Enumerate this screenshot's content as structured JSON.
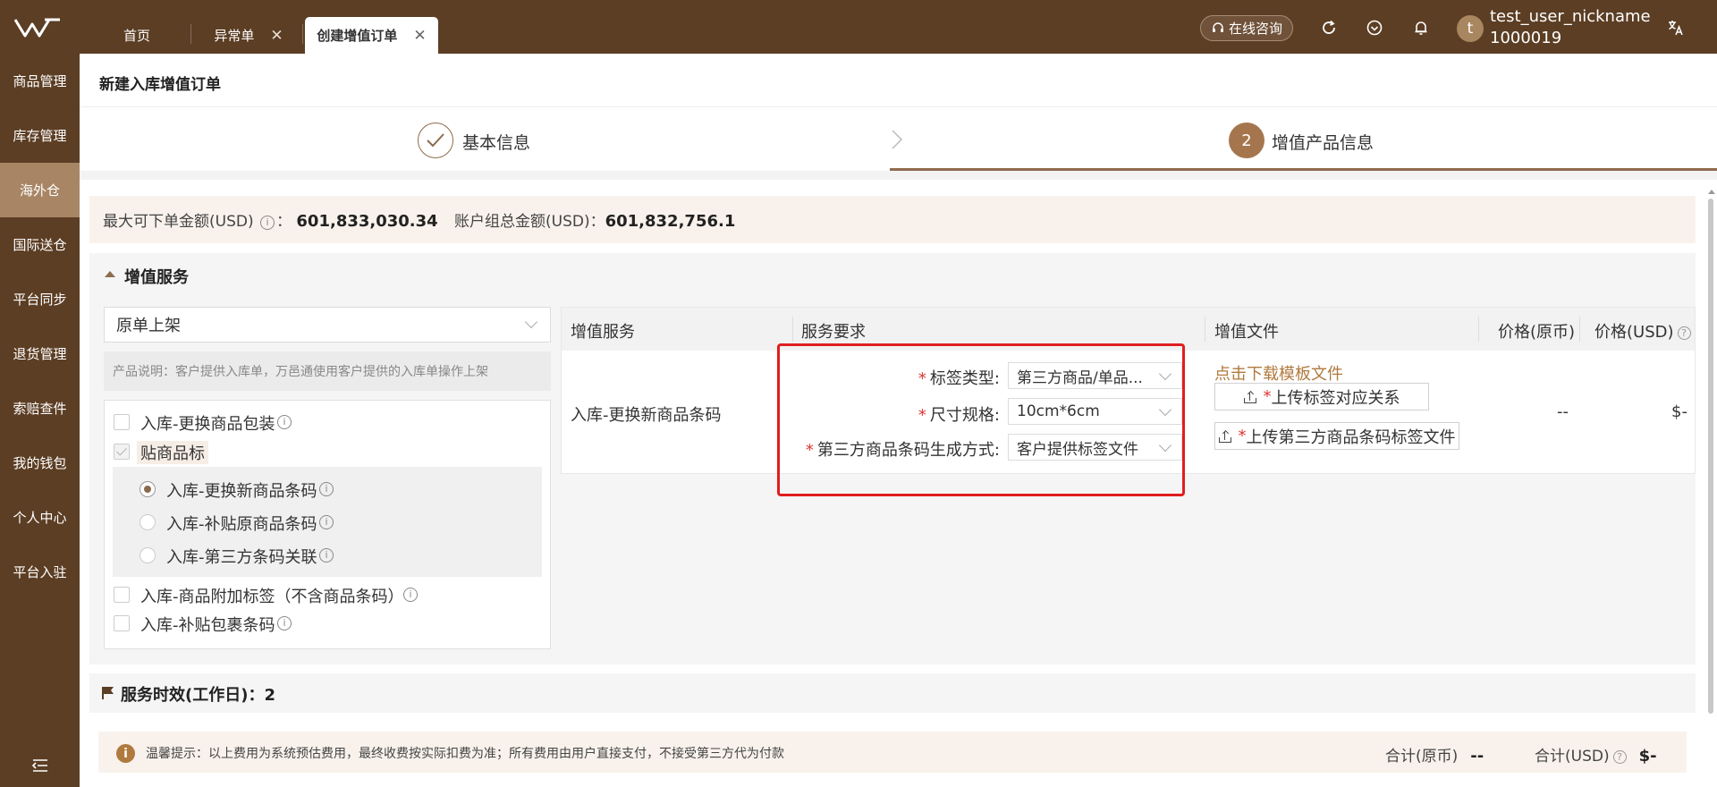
{
  "tabs": [
    {
      "label": "首页"
    },
    {
      "label": "异常单"
    },
    {
      "label": "创建增值订单"
    }
  ],
  "header": {
    "consult_label": "在线咨询",
    "user_name": "test_user_nickname",
    "user_id": "1000019",
    "avatar_letter": "t"
  },
  "sidebar": {
    "items": [
      {
        "label": "商品管理"
      },
      {
        "label": "库存管理"
      },
      {
        "label": "海外仓"
      },
      {
        "label": "国际送仓"
      },
      {
        "label": "平台同步"
      },
      {
        "label": "退货管理"
      },
      {
        "label": "索赔查件"
      },
      {
        "label": "我的钱包"
      },
      {
        "label": "个人中心"
      },
      {
        "label": "平台入驻"
      }
    ]
  },
  "page": {
    "title": "新建入库增值订单"
  },
  "steps": [
    {
      "label": "基本信息"
    },
    {
      "label": "增值产品信息",
      "number": "2"
    }
  ],
  "amounts": {
    "max_order_label": "最大可下单金额(USD)",
    "max_order_value": "601,833,030.34",
    "group_total_label": "账户组总金额(USD)：",
    "group_total_value": "601,832,756.1"
  },
  "vas": {
    "section_title": "增值服务",
    "select_value": "原单上架",
    "description": "产品说明：客户提供入库单，万邑通使用客户提供的入库单操作上架",
    "options": [
      {
        "label": "入库-更换商品包装",
        "checked": false
      },
      {
        "label": "贴商品标",
        "checked": true
      },
      {
        "label": "入库-商品附加标签（不含商品条码）",
        "checked": false
      },
      {
        "label": "入库-补贴包裹条码",
        "checked": false
      }
    ],
    "sub_options": [
      {
        "label": "入库-更换新商品条码",
        "checked": true
      },
      {
        "label": "入库-补贴原商品条码",
        "checked": false
      },
      {
        "label": "入库-第三方条码关联",
        "checked": false
      }
    ]
  },
  "table": {
    "headers": {
      "service": "增值服务",
      "requirement": "服务要求",
      "file": "增值文件",
      "price_orig": "价格(原币)",
      "price_usd": "价格(USD)"
    },
    "row": {
      "service": "入库-更换新商品条码",
      "requirements": [
        {
          "label": "标签类型:",
          "value": "第三方商品/单品..."
        },
        {
          "label": "尺寸规格:",
          "value": "10cm*6cm"
        },
        {
          "label": "第三方商品条码生成方式:",
          "value": "客户提供标签文件"
        }
      ],
      "download_link": "点击下载模板文件",
      "upload1": "上传标签对应关系",
      "upload2": "上传第三方商品条码标签文件",
      "price_orig": "--",
      "price_usd": "$-"
    }
  },
  "service_time": {
    "label": "服务时效(工作日)：2"
  },
  "footer": {
    "tip": "温馨提示：以上费用为系统预估费用，最终收费按实际扣费为准；所有费用由用户直接支付，不接受第三方代为付款",
    "sum_orig_label": "合计(原币)",
    "sum_orig_value": "--",
    "sum_usd_label": "合计(USD)",
    "sum_usd_value": "$-"
  },
  "colors": {
    "brand": "#5c3e24",
    "accent": "#8d6b4d",
    "sidebar_active": "#a88665",
    "link": "#b07a3e",
    "highlight_box": "#e01e1e"
  }
}
